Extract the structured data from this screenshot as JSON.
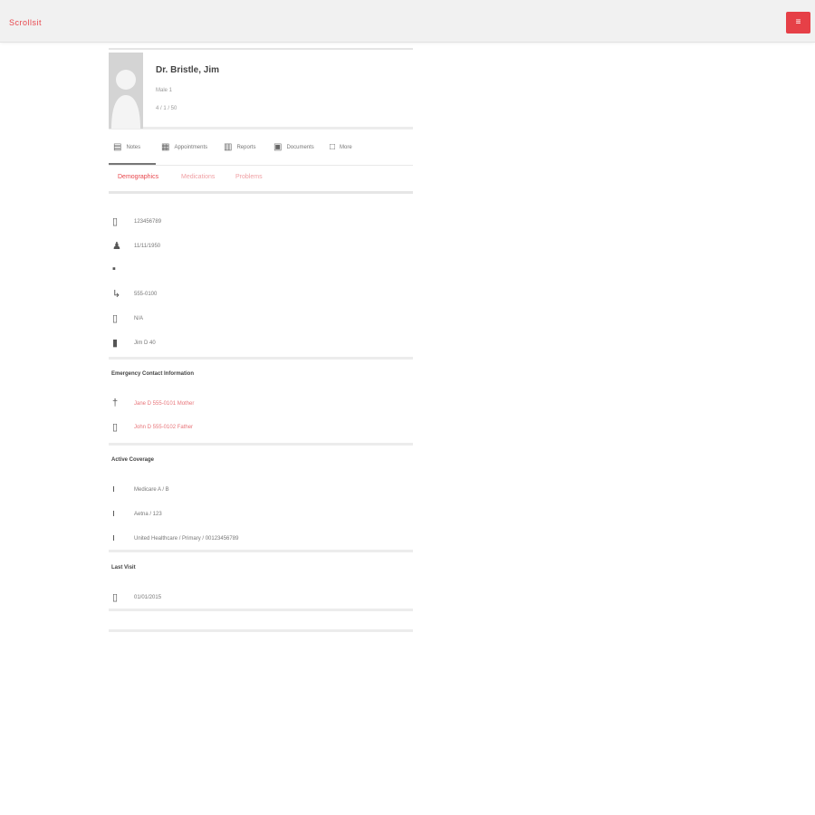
{
  "header": {
    "logo_text": "Scrollsit",
    "menu_icon": "hamburger-icon",
    "accent_color": "#e64047"
  },
  "profile": {
    "name": "Dr. Bristle, Jim",
    "line1": "Male 1",
    "line2": "4 / 1 / 50"
  },
  "actions": [
    {
      "icon": "note-icon",
      "label": "Notes"
    },
    {
      "icon": "appointments-icon",
      "label": "Appointments"
    },
    {
      "icon": "reports-icon",
      "label": "Reports"
    },
    {
      "icon": "documents-icon",
      "label": "Documents"
    },
    {
      "icon": "more-icon",
      "label": "More"
    }
  ],
  "tabs": [
    {
      "label": "Demographics",
      "active": true
    },
    {
      "label": "Medications",
      "active": false
    },
    {
      "label": "Problems",
      "active": false
    }
  ],
  "info": [
    {
      "icon": "id-card-icon",
      "text": "123456789"
    },
    {
      "icon": "person-icon",
      "text": "11/11/1950"
    },
    {
      "icon": "home-icon",
      "text": ""
    },
    {
      "icon": "phone-icon",
      "text": "555-0100"
    },
    {
      "icon": "mobile-icon",
      "text": "N/A"
    },
    {
      "icon": "email-icon",
      "text": "Jim D 40"
    }
  ],
  "emergency": {
    "title": "Emergency Contact Information",
    "items": [
      {
        "icon": "person-icon",
        "text": "Jane D 555-0101 Mother"
      },
      {
        "icon": "phone-icon",
        "text": "John D 555-0102 Father"
      }
    ]
  },
  "insurance": {
    "title": "Active Coverage",
    "items": [
      {
        "icon": "info-icon",
        "text": "Medicare A / B"
      },
      {
        "icon": "info-icon",
        "text": "Aetna / 123"
      },
      {
        "icon": "info-icon",
        "text": "United Healthcare / Primary / 00123456789"
      }
    ]
  },
  "pharmacy": {
    "title": "Last Visit",
    "items": [
      {
        "icon": "pharmacy-icon",
        "text": "01/01/2015"
      }
    ]
  }
}
